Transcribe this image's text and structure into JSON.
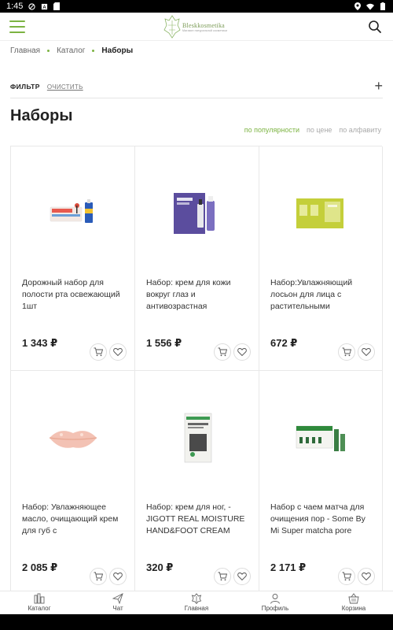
{
  "status_bar": {
    "time": "1:45"
  },
  "header": {
    "logo_name": "Bleskkosmetika",
    "logo_sub": "Магазин натуральной косметики"
  },
  "breadcrumb": [
    "Главная",
    "Каталог",
    "Наборы"
  ],
  "filter": {
    "label": "ФИЛЬТР",
    "clear": "ОЧИСТИТЬ",
    "expand": "+"
  },
  "page_title": "Наборы",
  "sort": [
    "по популярности",
    "по цене",
    "по алфавиту"
  ],
  "products": [
    {
      "name": "Дорожный набор для полости рта освежающий 1шт",
      "price": "1 343 ₽"
    },
    {
      "name": "Набор: крем для кожи вокруг глаз и антивозрастная",
      "price": "1 556 ₽"
    },
    {
      "name": "Набор:Увлажняющий лосьон для лица с растительными",
      "price": "672 ₽"
    },
    {
      "name": "Набор: Увлажняющее масло, очищающий крем для губ с",
      "price": "2 085 ₽"
    },
    {
      "name": "Набор: крем для ног, - JIGOTT REAL MOISTURE HAND&FOOT CREAM",
      "price": "320 ₽"
    },
    {
      "name": "Набор с чаем матча для очищения пор - Some By Mi Super matcha pore",
      "price": "2 171 ₽"
    }
  ],
  "bottom_nav": [
    "Каталог",
    "Чат",
    "Главная",
    "Профиль",
    "Корзина"
  ],
  "colors": {
    "accent": "#7cb342"
  }
}
